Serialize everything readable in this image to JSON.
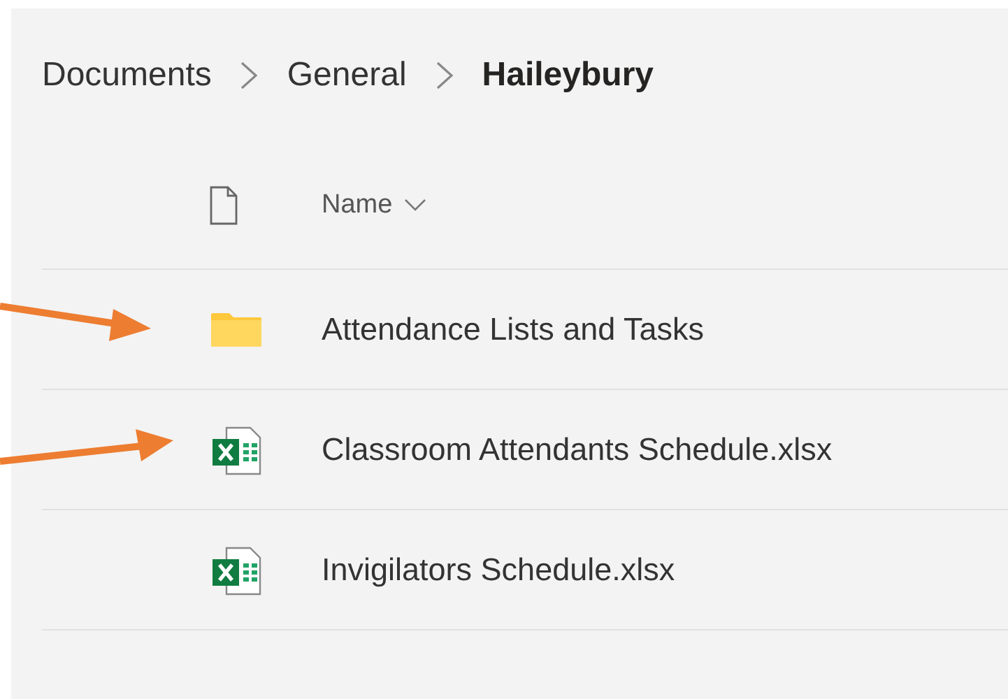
{
  "breadcrumb": [
    {
      "label": "Documents",
      "current": false
    },
    {
      "label": "General",
      "current": false
    },
    {
      "label": "Haileybury",
      "current": true
    }
  ],
  "table": {
    "columns": [
      {
        "label": "Name",
        "sortable": true
      }
    ],
    "rows": [
      {
        "name": "Attendance Lists and Tasks",
        "kind": "folder"
      },
      {
        "name": "Classroom Attendants Schedule.xlsx",
        "kind": "excel"
      },
      {
        "name": "Invigilators Schedule.xlsx",
        "kind": "excel"
      }
    ]
  }
}
